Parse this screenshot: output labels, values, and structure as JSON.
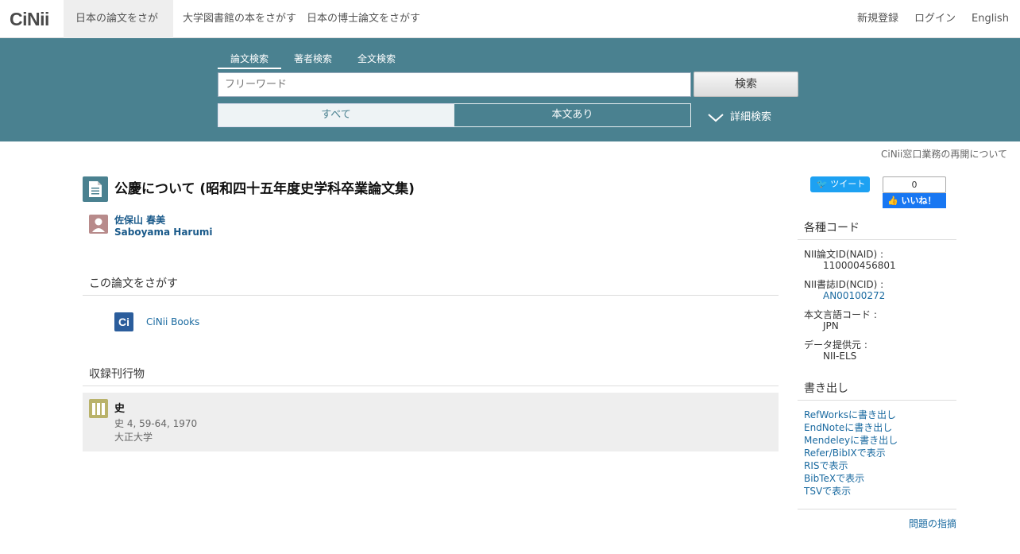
{
  "nav": {
    "logo": "CiNii",
    "tabs": [
      "日本の論文をさがす",
      "大学図書館の本をさがす",
      "日本の博士論文をさがす"
    ],
    "right": [
      "新規登録",
      "ログイン",
      "English"
    ]
  },
  "search": {
    "tabs": [
      "論文検索",
      "著者検索",
      "全文検索"
    ],
    "placeholder": "フリーワード",
    "button": "検索",
    "filters": [
      "すべて",
      "本文あり"
    ],
    "detail": "詳細検索"
  },
  "notice": "CiNii窓口業務の再開について",
  "article": {
    "title": "公慶について (昭和四十五年度史学科卒業論文集)",
    "author_ja": "佐保山 春美",
    "author_en": "Saboyama Harumi"
  },
  "find": {
    "heading": "この論文をさがす",
    "link": "CiNii Books"
  },
  "journal": {
    "heading": "収録刊行物",
    "name": "史",
    "volume": "史 4, 59-64, 1970",
    "publisher": "大正大学"
  },
  "social": {
    "tweet": "ツイート",
    "like_count": "0",
    "like": "いいね！"
  },
  "codes": {
    "heading": "各種コード",
    "naid_label": "NII論文ID(NAID) :",
    "naid": "110000456801",
    "ncid_label": "NII書誌ID(NCID) :",
    "ncid": "AN00100272",
    "lang_label": "本文言語コード :",
    "lang": "JPN",
    "provider_label": "データ提供元 :",
    "provider": "NII-ELS"
  },
  "export": {
    "heading": "書き出し",
    "items": [
      "RefWorksに書き出し",
      "EndNoteに書き出し",
      "Mendeleyに書き出し",
      "Refer/BibIXで表示",
      "RISで表示",
      "BibTeXで表示",
      "TSVで表示"
    ]
  },
  "report": "問題の指摘",
  "colors": {
    "band": "#4a8190",
    "link": "#1a6aa0"
  }
}
